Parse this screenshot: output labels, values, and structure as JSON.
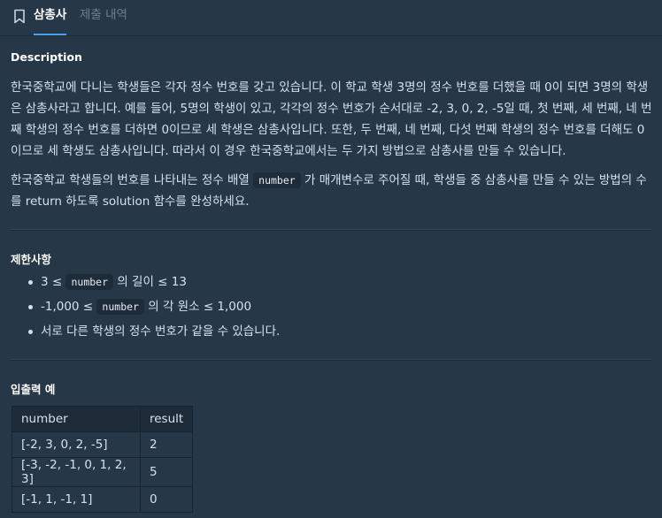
{
  "tabs": {
    "active": "삼총사",
    "inactive": "제출 내역"
  },
  "description": {
    "heading": "Description",
    "p1": "한국중학교에 다니는 학생들은 각자 정수 번호를 갖고 있습니다. 이 학교 학생 3명의 정수 번호를 더했을 때 0이 되면 3명의 학생은 삼총사라고 합니다. 예를 들어, 5명의 학생이 있고, 각각의 정수 번호가 순서대로 -2, 3, 0, 2, -5일 때, 첫 번째, 세 번째, 네 번째 학생의 정수 번호를 더하면 0이므로 세 학생은 삼총사입니다. 또한, 두 번째, 네 번째, 다섯 번째 학생의 정수 번호를 더해도 0이므로 세 학생도 삼총사입니다. 따라서 이 경우 한국중학교에서는 두 가지 방법으로 삼총사를 만들 수 있습니다.",
    "p2_before": "한국중학교 학생들의 번호를 나타내는 정수 배열 ",
    "p2_code": "number",
    "p2_after": " 가 매개변수로 주어질 때, 학생들 중 삼총사를 만들 수 있는 방법의 수를 return 하도록 solution 함수를 완성하세요."
  },
  "constraints": {
    "heading": "제한사항",
    "item1_before": "3 ≤ ",
    "item1_code": "number",
    "item1_after": " 의 길이 ≤ 13",
    "item2_before": "-1,000 ≤ ",
    "item2_code": "number",
    "item2_after": " 의 각 원소 ≤ 1,000",
    "item3": "서로 다른 학생의 정수 번호가 같을 수 있습니다."
  },
  "examples": {
    "heading": "입출력 예",
    "col_number": "number",
    "col_result": "result",
    "rows": [
      {
        "number": "[-2, 3, 0, 2, -5]",
        "result": "2"
      },
      {
        "number": "[-3, -2, -1, 0, 1, 2, 3]",
        "result": "5"
      },
      {
        "number": "[-1, 1, -1, 1]",
        "result": "0"
      }
    ]
  },
  "icons": {
    "bookmark": "bookmark-icon"
  },
  "colors": {
    "background": "#263747",
    "accent": "#4aa0f7"
  }
}
